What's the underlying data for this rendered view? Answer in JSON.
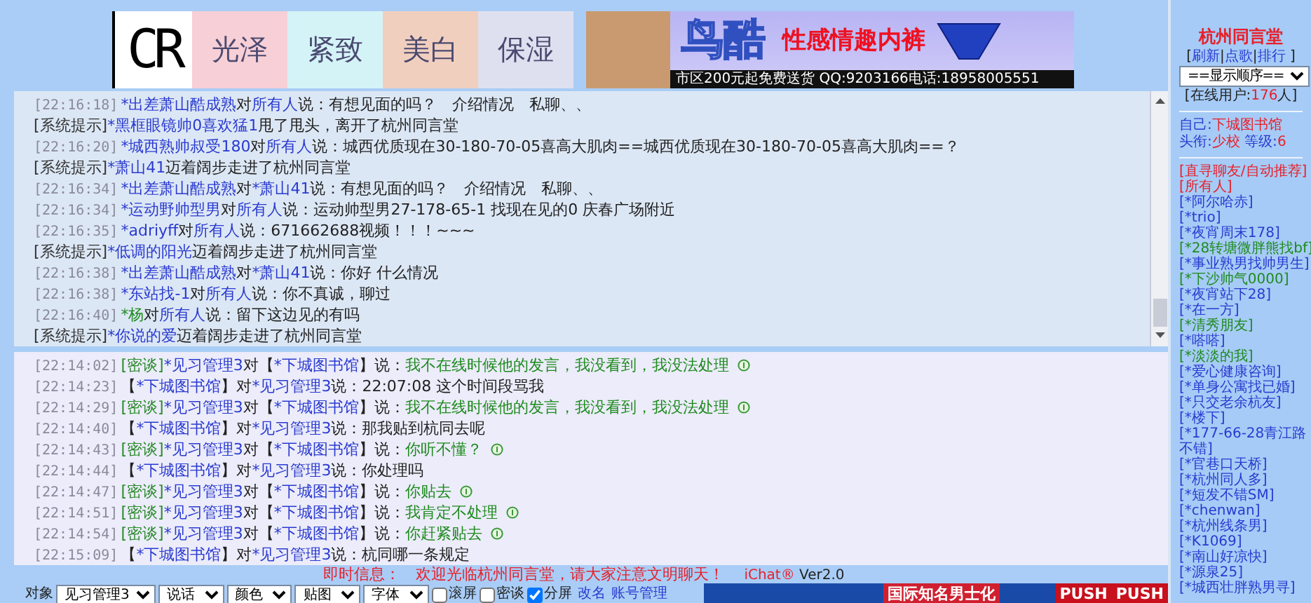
{
  "banner": {
    "logo": "CR",
    "tiles": [
      {
        "text": "光泽",
        "color": "#f7cfd6"
      },
      {
        "text": "紧致",
        "color": "#d4f3f7"
      },
      {
        "text": "美白",
        "color": "#f1cfbf"
      },
      {
        "text": "保湿",
        "color": "#dfe0ef"
      }
    ],
    "ad": {
      "brand": "鸟酷",
      "slogan": "性感情趣内裤",
      "footer": "市区200元起免费送货 QQ:9203166电话:18958005551"
    }
  },
  "upper_messages": [
    {
      "time": "[22:16:18]",
      "parts": [
        {
          "kind": "name",
          "text": "*出差萧山酷成熟"
        },
        {
          "kind": "plain",
          "text": "对"
        },
        {
          "kind": "name",
          "text": "所有人"
        },
        {
          "kind": "plain",
          "text": "说：有想见面的吗？　介绍情况　私聊、、"
        }
      ]
    },
    {
      "parts": [
        {
          "kind": "label",
          "text": "[系统提示]"
        },
        {
          "kind": "name",
          "text": "*黑框眼镜帅0喜欢猛1"
        },
        {
          "kind": "plain",
          "text": "甩了甩头，离开了杭州同言堂"
        }
      ]
    },
    {
      "time": "[22:16:20]",
      "parts": [
        {
          "kind": "name",
          "text": "*城西熟帅叔受180"
        },
        {
          "kind": "plain",
          "text": "对"
        },
        {
          "kind": "name",
          "text": "所有人"
        },
        {
          "kind": "plain",
          "text": "说：城西优质现在30-180-70-05喜高大肌肉==城西优质现在30-180-70-05喜高大肌肉==？"
        }
      ]
    },
    {
      "parts": [
        {
          "kind": "label",
          "text": "[系统提示]"
        },
        {
          "kind": "name",
          "text": "*萧山41"
        },
        {
          "kind": "plain",
          "text": "迈着阔步走进了杭州同言堂"
        }
      ]
    },
    {
      "time": "[22:16:34]",
      "parts": [
        {
          "kind": "name",
          "text": "*出差萧山酷成熟"
        },
        {
          "kind": "plain",
          "text": "对"
        },
        {
          "kind": "name",
          "text": "*萧山41"
        },
        {
          "kind": "plain",
          "text": "说：有想见面的吗？　介绍情况　私聊、、"
        }
      ]
    },
    {
      "time": "[22:16:34]",
      "parts": [
        {
          "kind": "name",
          "text": "*运动野帅型男"
        },
        {
          "kind": "plain",
          "text": "对"
        },
        {
          "kind": "name",
          "text": "所有人"
        },
        {
          "kind": "plain",
          "text": "说：运动帅型男27-178-65-1 找现在见的0 庆春广场附近"
        }
      ]
    },
    {
      "time": "[22:16:35]",
      "parts": [
        {
          "kind": "name",
          "text": "*adriyff"
        },
        {
          "kind": "plain",
          "text": "对"
        },
        {
          "kind": "name",
          "text": "所有人"
        },
        {
          "kind": "plain",
          "text": "说：671662688视频！！！~~~"
        }
      ]
    },
    {
      "parts": [
        {
          "kind": "label",
          "text": "[系统提示]"
        },
        {
          "kind": "name",
          "text": "*低调的阳光"
        },
        {
          "kind": "plain",
          "text": "迈着阔步走进了杭州同言堂"
        }
      ]
    },
    {
      "time": "[22:16:38]",
      "parts": [
        {
          "kind": "name",
          "text": "*出差萧山酷成熟"
        },
        {
          "kind": "plain",
          "text": "对"
        },
        {
          "kind": "name",
          "text": "*萧山41"
        },
        {
          "kind": "plain",
          "text": "说：你好 什么情况"
        }
      ]
    },
    {
      "time": "[22:16:38]",
      "parts": [
        {
          "kind": "name",
          "text": "*东站找-1"
        },
        {
          "kind": "plain",
          "text": "对"
        },
        {
          "kind": "name",
          "text": "所有人"
        },
        {
          "kind": "plain",
          "text": "说：你不真诚，聊过"
        }
      ]
    },
    {
      "time": "[22:16:40]",
      "parts": [
        {
          "kind": "name-green",
          "text": "*杨"
        },
        {
          "kind": "plain",
          "text": "对"
        },
        {
          "kind": "name",
          "text": "所有人"
        },
        {
          "kind": "plain",
          "text": "说：留下这边见的有吗"
        }
      ]
    },
    {
      "parts": [
        {
          "kind": "label",
          "text": "[系统提示]"
        },
        {
          "kind": "name",
          "text": "*你说的爱"
        },
        {
          "kind": "plain",
          "text": "迈着阔步走进了杭州同言堂"
        }
      ]
    }
  ],
  "lower_messages": [
    {
      "time": "[22:14:02]",
      "emote": true,
      "parts": [
        {
          "kind": "label-green",
          "text": "[密谈]"
        },
        {
          "kind": "name",
          "text": "*见习管理3"
        },
        {
          "kind": "plain",
          "text": "对【"
        },
        {
          "kind": "name",
          "text": "*下城图书馆"
        },
        {
          "kind": "plain",
          "text": "】说："
        },
        {
          "kind": "speech-green",
          "text": "我不在线时候他的发言，我没看到，我没法处理"
        }
      ]
    },
    {
      "time": "[22:14:23]",
      "emote": false,
      "parts": [
        {
          "kind": "plain",
          "text": "【"
        },
        {
          "kind": "name",
          "text": "*下城图书馆"
        },
        {
          "kind": "plain",
          "text": "】对"
        },
        {
          "kind": "name",
          "text": "*见习管理3"
        },
        {
          "kind": "plain",
          "text": "说：22:07:08 这个时间段骂我"
        }
      ]
    },
    {
      "time": "[22:14:29]",
      "emote": true,
      "parts": [
        {
          "kind": "label-green",
          "text": "[密谈]"
        },
        {
          "kind": "name",
          "text": "*见习管理3"
        },
        {
          "kind": "plain",
          "text": "对【"
        },
        {
          "kind": "name",
          "text": "*下城图书馆"
        },
        {
          "kind": "plain",
          "text": "】说："
        },
        {
          "kind": "speech-green",
          "text": "我不在线时候他的发言，我没看到，我没法处理"
        }
      ]
    },
    {
      "time": "[22:14:40]",
      "emote": false,
      "parts": [
        {
          "kind": "plain",
          "text": "【"
        },
        {
          "kind": "name",
          "text": "*下城图书馆"
        },
        {
          "kind": "plain",
          "text": "】对"
        },
        {
          "kind": "name",
          "text": "*见习管理3"
        },
        {
          "kind": "plain",
          "text": "说：那我贴到杭同去呢"
        }
      ]
    },
    {
      "time": "[22:14:43]",
      "emote": true,
      "parts": [
        {
          "kind": "label-green",
          "text": "[密谈]"
        },
        {
          "kind": "name",
          "text": "*见习管理3"
        },
        {
          "kind": "plain",
          "text": "对【"
        },
        {
          "kind": "name",
          "text": "*下城图书馆"
        },
        {
          "kind": "plain",
          "text": "】说："
        },
        {
          "kind": "speech-green",
          "text": "你听不懂？"
        }
      ]
    },
    {
      "time": "[22:14:44]",
      "emote": false,
      "parts": [
        {
          "kind": "plain",
          "text": "【"
        },
        {
          "kind": "name",
          "text": "*下城图书馆"
        },
        {
          "kind": "plain",
          "text": "】对"
        },
        {
          "kind": "name",
          "text": "*见习管理3"
        },
        {
          "kind": "plain",
          "text": "说：你处理吗"
        }
      ]
    },
    {
      "time": "[22:14:47]",
      "emote": true,
      "parts": [
        {
          "kind": "label-green",
          "text": "[密谈]"
        },
        {
          "kind": "name",
          "text": "*见习管理3"
        },
        {
          "kind": "plain",
          "text": "对【"
        },
        {
          "kind": "name",
          "text": "*下城图书馆"
        },
        {
          "kind": "plain",
          "text": "】说："
        },
        {
          "kind": "speech-green",
          "text": "你贴去"
        }
      ]
    },
    {
      "time": "[22:14:51]",
      "emote": true,
      "parts": [
        {
          "kind": "label-green",
          "text": "[密谈]"
        },
        {
          "kind": "name",
          "text": "*见习管理3"
        },
        {
          "kind": "plain",
          "text": "对【"
        },
        {
          "kind": "name",
          "text": "*下城图书馆"
        },
        {
          "kind": "plain",
          "text": "】说："
        },
        {
          "kind": "speech-green",
          "text": "我肯定不处理"
        }
      ]
    },
    {
      "time": "[22:14:54]",
      "emote": true,
      "parts": [
        {
          "kind": "label-green",
          "text": "[密谈]"
        },
        {
          "kind": "name",
          "text": "*见习管理3"
        },
        {
          "kind": "plain",
          "text": "对【"
        },
        {
          "kind": "name",
          "text": "*下城图书馆"
        },
        {
          "kind": "plain",
          "text": "】说："
        },
        {
          "kind": "speech-green",
          "text": "你赶紧贴去"
        }
      ]
    },
    {
      "time": "[22:15:09]",
      "emote": false,
      "parts": [
        {
          "kind": "plain",
          "text": "【"
        },
        {
          "kind": "name",
          "text": "*下城图书馆"
        },
        {
          "kind": "plain",
          "text": "】对"
        },
        {
          "kind": "name",
          "text": "*见习管理3"
        },
        {
          "kind": "plain",
          "text": "说：杭同哪一条规定"
        }
      ]
    }
  ],
  "notice": {
    "parts": [
      {
        "kind": "red",
        "text": "即时信息：　欢迎光临杭州同言堂，请大家注意文明聊天！"
      }
    ]
  },
  "version": {
    "parts": [
      {
        "kind": "red",
        "text": "iChat®"
      },
      {
        "kind": "plain",
        "text": " Ver2.0"
      }
    ]
  },
  "controls": {
    "label": "对象",
    "selects": [
      "见习管理3",
      "说话",
      "颜色",
      "贴图",
      "字体"
    ],
    "checkboxes": [
      {
        "label": "滚屏",
        "checked": false
      },
      {
        "label": "密谈",
        "checked": false
      },
      {
        "label": "分屏",
        "checked": true
      }
    ],
    "links": [
      "改名",
      "账号管理"
    ]
  },
  "bottom_ads": [
    "国际知名男士化",
    "PUSH",
    "PUSH"
  ],
  "sidebar": {
    "title": "杭州同言堂",
    "menu": [
      {
        "kind": "plain",
        "text": "["
      },
      {
        "kind": "link",
        "text": "刷新"
      },
      {
        "kind": "plain",
        "text": "|"
      },
      {
        "kind": "link",
        "text": "点歌"
      },
      {
        "kind": "plain",
        "text": "|"
      },
      {
        "kind": "link",
        "text": "排行"
      },
      {
        "kind": "plain",
        "text": " ]"
      }
    ],
    "order_select": "==显示顺序==",
    "online": [
      {
        "kind": "plain",
        "text": "[在线用户:"
      },
      {
        "kind": "red",
        "text": "176"
      },
      {
        "kind": "plain",
        "text": "人]"
      }
    ],
    "self": [
      {
        "kind": "blue",
        "text": "自己:"
      },
      {
        "kind": "red",
        "text": "下城图书馆"
      }
    ],
    "rank": [
      {
        "kind": "blue",
        "text": "头衔:"
      },
      {
        "kind": "red",
        "text": "少校"
      },
      {
        "kind": "blue",
        "text": " 等级:"
      },
      {
        "kind": "red",
        "text": "6"
      }
    ],
    "users": [
      {
        "text": "[直寻聊友/自动推荐]",
        "color": "#e8202a"
      },
      {
        "text": "[所有人]",
        "color": "#e8202a"
      },
      {
        "text": "[*阿尔哈赤]",
        "color": "#2a3ad0"
      },
      {
        "text": "[*trio]",
        "color": "#2a3ad0"
      },
      {
        "text": "[*夜宵周末178]",
        "color": "#2a3ad0"
      },
      {
        "text": "[*28转塘微胖熊找bf]",
        "color": "#1e8a1e"
      },
      {
        "text": "[*事业熟男找帅男生]",
        "color": "#2a3ad0"
      },
      {
        "text": "[*下沙帅气0000]",
        "color": "#1e8a1e"
      },
      {
        "text": "[*夜宵站下28]",
        "color": "#2a3ad0"
      },
      {
        "text": "[*在一方]",
        "color": "#2a3ad0"
      },
      {
        "text": "[*清秀朋友]",
        "color": "#1e8a1e"
      },
      {
        "text": "[*嗒嗒]",
        "color": "#2a3ad0"
      },
      {
        "text": "[*淡淡的我]",
        "color": "#1e8a1e"
      },
      {
        "text": "[*爱心健康咨询]",
        "color": "#2a3ad0"
      },
      {
        "text": "[*单身公寓找已婚]",
        "color": "#2a3ad0"
      },
      {
        "text": "[*只交老余杭友]",
        "color": "#2a3ad0"
      },
      {
        "text": "[*楼下]",
        "color": "#2a3ad0"
      },
      {
        "text": "[*177-66-28青江路不错]",
        "color": "#2a3ad0"
      },
      {
        "text": "[*官巷口天桥]",
        "color": "#2a3ad0"
      },
      {
        "text": "[*杭州同人多]",
        "color": "#2a3ad0"
      },
      {
        "text": "[*短发不错SM]",
        "color": "#2a3ad0"
      },
      {
        "text": "[*chenwan]",
        "color": "#2a3ad0"
      },
      {
        "text": "[*杭州线条男]",
        "color": "#2a3ad0"
      },
      {
        "text": "[*K1069]",
        "color": "#2a3ad0"
      },
      {
        "text": "[*南山好凉快]",
        "color": "#2a3ad0"
      },
      {
        "text": "[*源泉25]",
        "color": "#2a3ad0"
      },
      {
        "text": "[*城西壮胖熟男寻]",
        "color": "#2a3ad0"
      }
    ]
  }
}
